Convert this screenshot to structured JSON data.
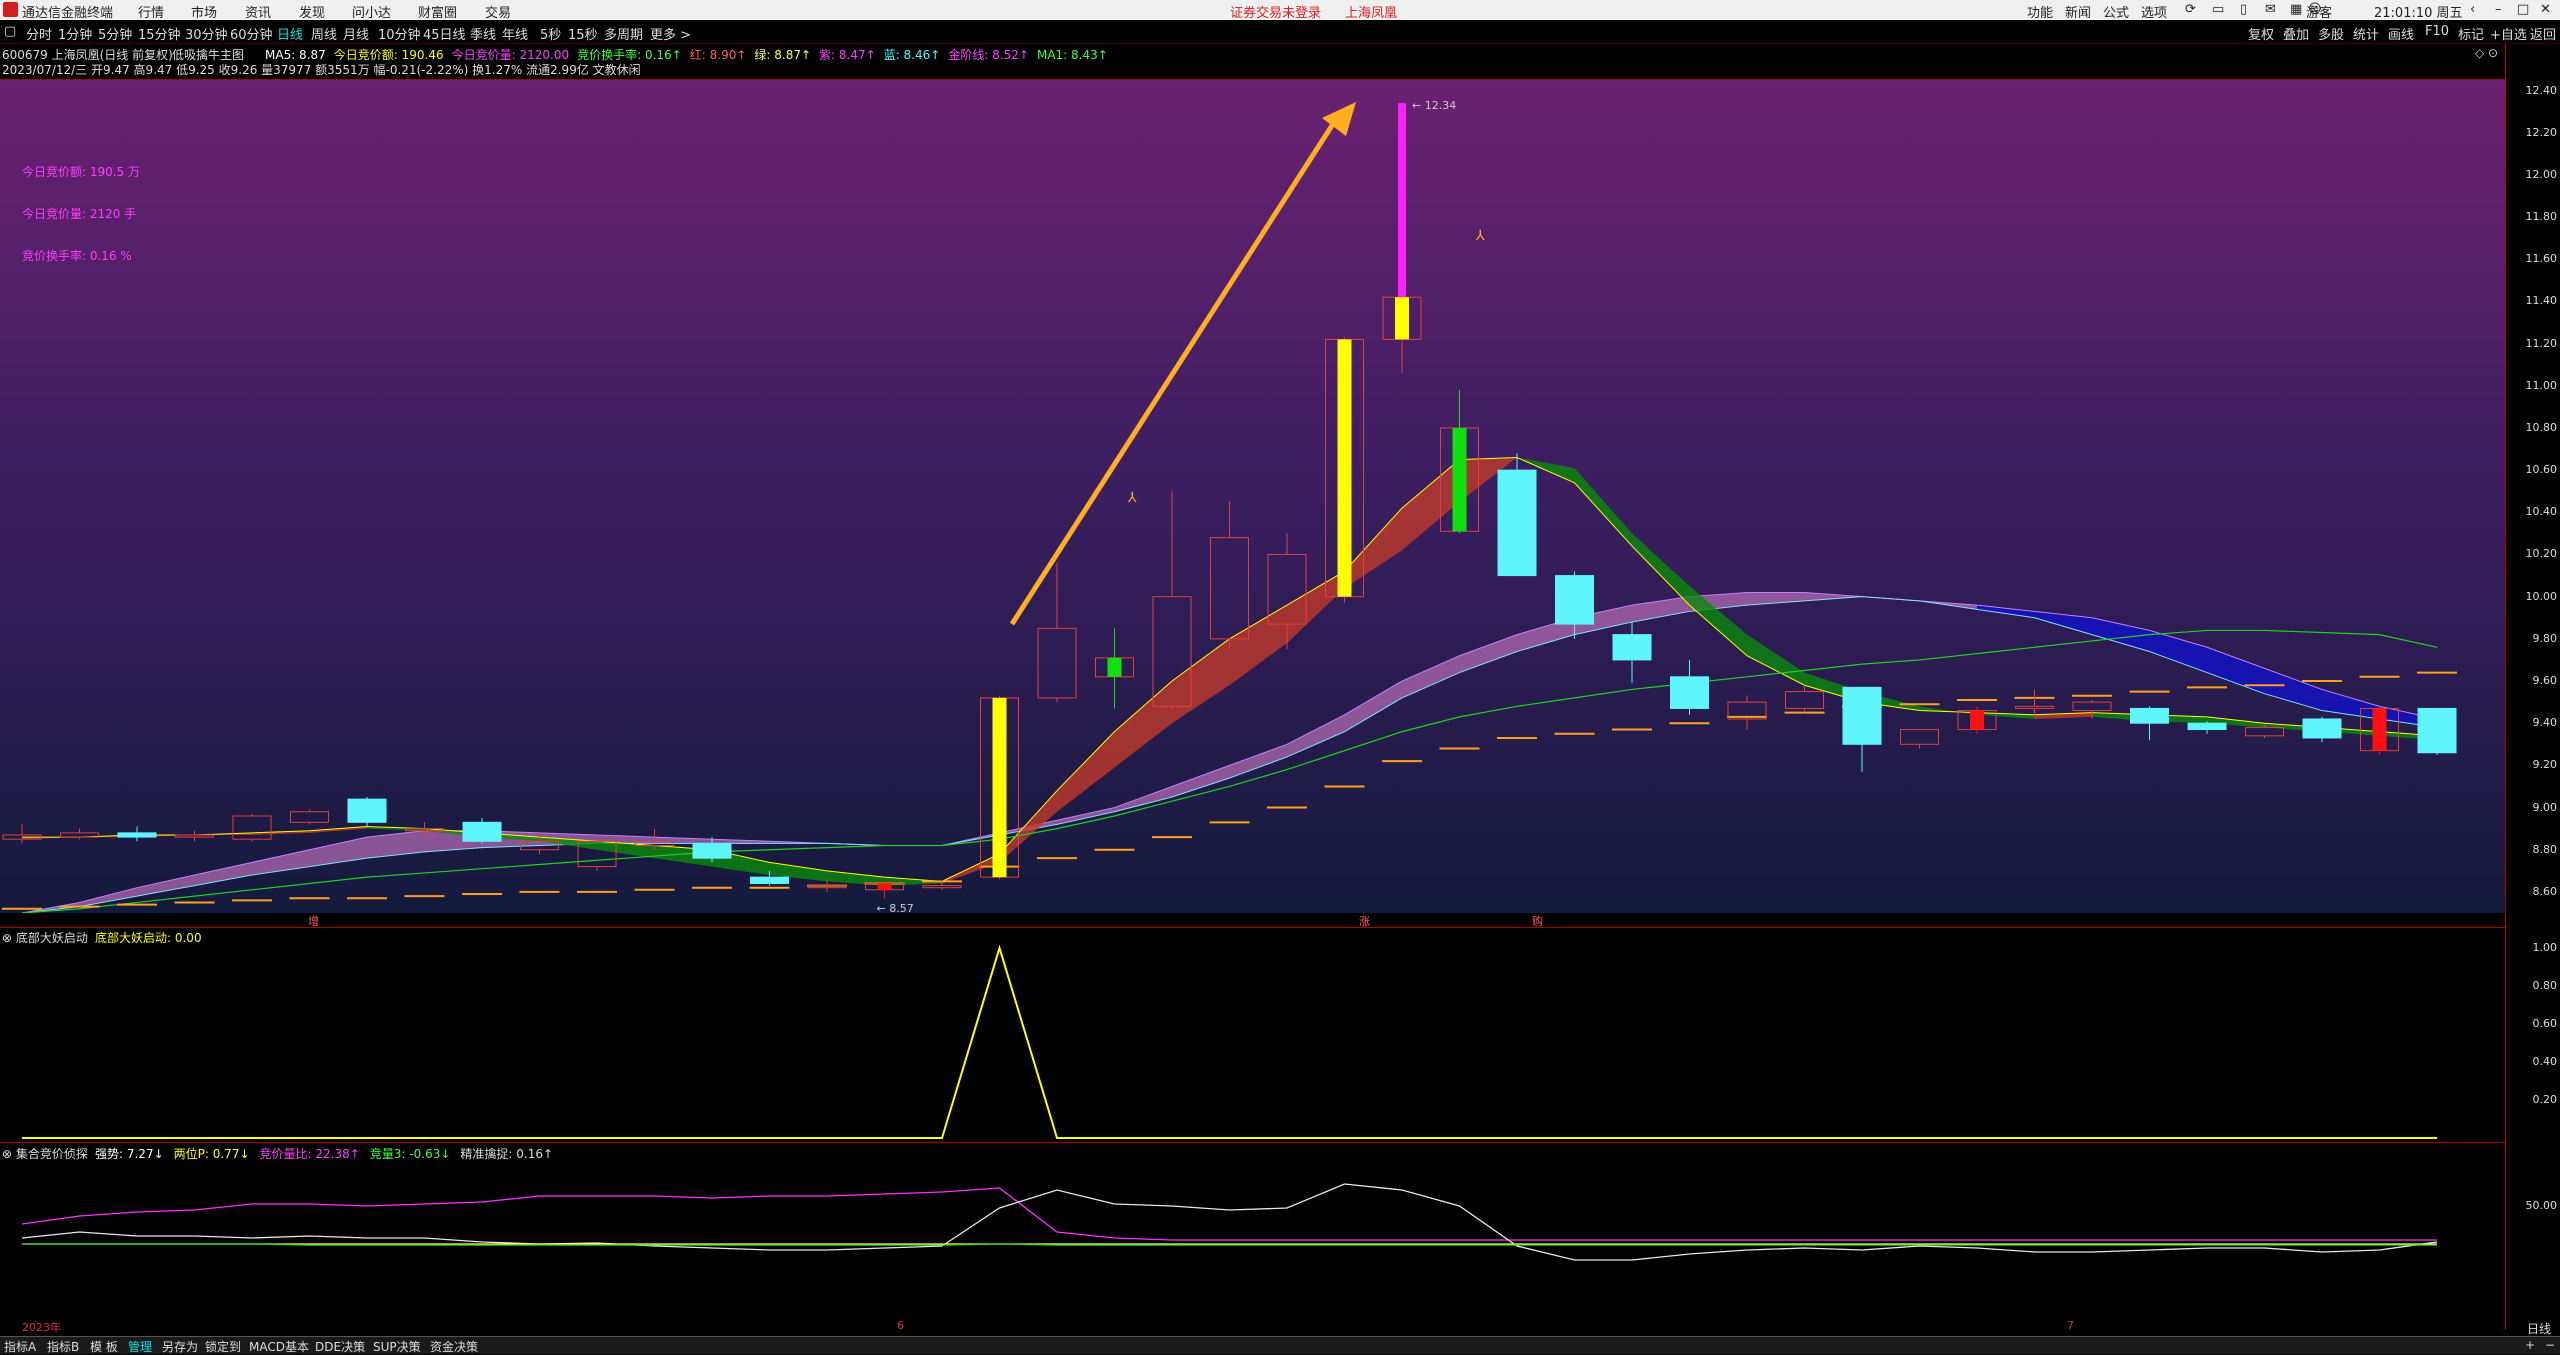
{
  "titlebar": {
    "app_name": "通达信金融终端",
    "menu": [
      "行情",
      "市场",
      "资讯",
      "发现",
      "问小达",
      "财富圈",
      "交易"
    ],
    "notice": "证券交易未登录",
    "notice_stock": "上海凤凰",
    "right_menu": [
      "功能",
      "新闻",
      "公式",
      "选项"
    ],
    "user": "游客",
    "clock": "21:01:10 周五"
  },
  "timeframes": {
    "items": [
      "分时",
      "1分钟",
      "5分钟",
      "15分钟",
      "30分钟",
      "60分钟",
      "日线",
      "周线",
      "月线",
      "10分钟",
      "45日线",
      "季线",
      "年线",
      "5秒",
      "15秒",
      "多周期",
      "更多 >"
    ],
    "active_index": 6,
    "right_tools": [
      "复权",
      "叠加",
      "多股",
      "统计",
      "画线",
      "F10",
      "标记",
      "+自选",
      "返回"
    ]
  },
  "info": {
    "line1_stock": "600679 上海凤凰(日线 前复权)",
    "line1_indicator": "低吸擒牛主图",
    "line1_values": [
      {
        "label": "MA5: 8.87",
        "color": "#ffffff"
      },
      {
        "label": "今日竞价额: 190.46",
        "color": "#ffff00"
      },
      {
        "label": "今日竞价量: 2120.00",
        "color": "#ff40ff"
      },
      {
        "label": "竞价换手率: 0.16↑",
        "color": "#40ff40"
      },
      {
        "label": "红: 8.90↑",
        "color": "#ff6060"
      },
      {
        "label": "绿: 8.87↑",
        "color": "#ffff40"
      },
      {
        "label": "紫: 8.47↑",
        "color": "#ff40ff"
      },
      {
        "label": "蓝: 8.46↑",
        "color": "#40ffff"
      },
      {
        "label": "金阶线: 8.52↑",
        "color": "#ff40ff"
      },
      {
        "label": "MA1: 8.43↑",
        "color": "#40ff40"
      }
    ],
    "line2": "2023/07/12/三 开9.47 高9.47 低9.25 收9.26 量37977 额3551万 幅-0.21(-2.22%) 换1.27% 流通2.99亿 文教休闲"
  },
  "overlay_text": {
    "auction_amount": "今日竞价额:  190.5  万",
    "auction_volume": "今日竞价量:  2120  手",
    "auction_turnover": "竞价换手率:  0.16  %",
    "high_label": "12.34",
    "low_label": "8.57",
    "mark_zeng": "增",
    "mark_zhang": "涨",
    "mark_gou": "购"
  },
  "price_axis": {
    "ticks": [
      "12.40",
      "12.20",
      "12.00",
      "11.80",
      "11.60",
      "11.40",
      "11.20",
      "11.00",
      "10.80",
      "10.60",
      "10.40",
      "10.20",
      "10.00",
      "9.80",
      "9.60",
      "9.40",
      "9.20",
      "9.00",
      "8.80",
      "8.60"
    ]
  },
  "panel2": {
    "title": "底部大妖启动",
    "value_label": "底部大妖启动: 0.00",
    "ticks": [
      "1.00",
      "0.80",
      "0.60",
      "0.40",
      "0.20"
    ]
  },
  "panel3": {
    "title": "集合竞价侦探",
    "values": [
      {
        "label": "强势: 7.27↓",
        "color": "#ffffff"
      },
      {
        "label": "两位P: 0.77↓",
        "color": "#ffff00"
      },
      {
        "label": "竞价量比: 22.38↑",
        "color": "#ff40ff"
      },
      {
        "label": "竞量3: -0.63↓",
        "color": "#40ff40"
      },
      {
        "label": "精准擒捉: 0.16↑",
        "color": "#dddddd"
      }
    ],
    "ticks": [
      "50.00"
    ]
  },
  "datebar": {
    "labels": [
      "2023年",
      "6",
      "7"
    ],
    "right": "日线"
  },
  "bottom_tabs": [
    "指标A",
    "指标B",
    "模 板",
    "管理",
    "另存为",
    "锁定到",
    "MACD基本",
    "DDE决策",
    "SUP决策",
    "资金决策"
  ],
  "chart_data": {
    "type": "candlestick",
    "ylim": [
      8.5,
      12.45
    ],
    "candles": [
      {
        "o": 8.85,
        "c": 8.87,
        "h": 8.92,
        "l": 8.83,
        "color": "red"
      },
      {
        "o": 8.86,
        "c": 8.88,
        "h": 8.9,
        "l": 8.85,
        "color": "red"
      },
      {
        "o": 8.88,
        "c": 8.86,
        "h": 8.91,
        "l": 8.84,
        "color": "cyan"
      },
      {
        "o": 8.86,
        "c": 8.87,
        "h": 8.89,
        "l": 8.84,
        "color": "red"
      },
      {
        "o": 8.85,
        "c": 8.96,
        "h": 8.97,
        "l": 8.84,
        "color": "red"
      },
      {
        "o": 8.93,
        "c": 8.98,
        "h": 8.99,
        "l": 8.92,
        "color": "red"
      },
      {
        "o": 9.04,
        "c": 8.93,
        "h": 9.05,
        "l": 8.91,
        "color": "cyan"
      },
      {
        "o": 8.9,
        "c": 8.89,
        "h": 8.93,
        "l": 8.85,
        "color": "red"
      },
      {
        "o": 8.93,
        "c": 8.84,
        "h": 8.95,
        "l": 8.83,
        "color": "cyan"
      },
      {
        "o": 8.8,
        "c": 8.84,
        "h": 8.88,
        "l": 8.78,
        "color": "red"
      },
      {
        "o": 8.72,
        "c": 8.84,
        "h": 8.86,
        "l": 8.7,
        "color": "red"
      },
      {
        "o": 8.82,
        "c": 8.84,
        "h": 8.9,
        "l": 8.8,
        "color": "red"
      },
      {
        "o": 8.83,
        "c": 8.76,
        "h": 8.86,
        "l": 8.74,
        "color": "cyan"
      },
      {
        "o": 8.67,
        "c": 8.64,
        "h": 8.7,
        "l": 8.63,
        "color": "cyan"
      },
      {
        "o": 8.62,
        "c": 8.63,
        "h": 8.66,
        "l": 8.6,
        "color": "red"
      },
      {
        "o": 8.64,
        "c": 8.61,
        "h": 8.65,
        "l": 8.57,
        "color": "redfill"
      },
      {
        "o": 8.62,
        "c": 8.63,
        "h": 8.65,
        "l": 8.61,
        "color": "red"
      },
      {
        "o": 8.67,
        "c": 9.52,
        "h": 9.53,
        "l": 8.66,
        "color": "yellow"
      },
      {
        "o": 9.52,
        "c": 9.85,
        "h": 10.16,
        "l": 9.5,
        "color": "red"
      },
      {
        "o": 9.71,
        "c": 9.62,
        "h": 9.85,
        "l": 9.47,
        "color": "green"
      },
      {
        "o": 9.48,
        "c": 10.0,
        "h": 10.5,
        "l": 9.46,
        "color": "red"
      },
      {
        "o": 9.8,
        "c": 10.28,
        "h": 10.45,
        "l": 9.76,
        "color": "red"
      },
      {
        "o": 9.87,
        "c": 10.2,
        "h": 10.3,
        "l": 9.75,
        "color": "red"
      },
      {
        "o": 10.0,
        "c": 11.22,
        "h": 11.23,
        "l": 9.97,
        "color": "yellow"
      },
      {
        "o": 11.22,
        "c": 11.42,
        "h": 12.34,
        "l": 11.06,
        "color": "yellowmag"
      },
      {
        "o": 10.8,
        "c": 10.31,
        "h": 10.98,
        "l": 10.3,
        "color": "green"
      },
      {
        "o": 10.6,
        "c": 10.1,
        "h": 10.68,
        "l": 10.1,
        "color": "cyan"
      },
      {
        "o": 10.1,
        "c": 9.87,
        "h": 10.12,
        "l": 9.8,
        "color": "cyan"
      },
      {
        "o": 9.82,
        "c": 9.7,
        "h": 9.88,
        "l": 9.59,
        "color": "cyan"
      },
      {
        "o": 9.62,
        "c": 9.47,
        "h": 9.7,
        "l": 9.44,
        "color": "cyan"
      },
      {
        "o": 9.42,
        "c": 9.5,
        "h": 9.53,
        "l": 9.37,
        "color": "red"
      },
      {
        "o": 9.47,
        "c": 9.55,
        "h": 9.58,
        "l": 9.45,
        "color": "red"
      },
      {
        "o": 9.57,
        "c": 9.3,
        "h": 9.57,
        "l": 9.17,
        "color": "cyan"
      },
      {
        "o": 9.3,
        "c": 9.37,
        "h": 9.37,
        "l": 9.28,
        "color": "red"
      },
      {
        "o": 9.37,
        "c": 9.46,
        "h": 9.48,
        "l": 9.35,
        "color": "redfill"
      },
      {
        "o": 9.47,
        "c": 9.48,
        "h": 9.56,
        "l": 9.43,
        "color": "red"
      },
      {
        "o": 9.46,
        "c": 9.5,
        "h": 9.51,
        "l": 9.42,
        "color": "red"
      },
      {
        "o": 9.47,
        "c": 9.4,
        "h": 9.48,
        "l": 9.32,
        "color": "cyan"
      },
      {
        "o": 9.4,
        "c": 9.37,
        "h": 9.41,
        "l": 9.35,
        "color": "cyan"
      },
      {
        "o": 9.34,
        "c": 9.38,
        "h": 9.39,
        "l": 9.33,
        "color": "red"
      },
      {
        "o": 9.42,
        "c": 9.33,
        "h": 9.43,
        "l": 9.31,
        "color": "cyan"
      },
      {
        "o": 9.47,
        "c": 9.27,
        "h": 9.48,
        "l": 9.25,
        "color": "redfill"
      },
      {
        "o": 9.47,
        "c": 9.26,
        "h": 9.47,
        "l": 9.25,
        "color": "cyan"
      }
    ],
    "steps": [
      8.52,
      8.53,
      8.54,
      8.55,
      8.56,
      8.57,
      8.57,
      8.58,
      8.59,
      8.6,
      8.6,
      8.61,
      8.62,
      8.62,
      8.63,
      8.64,
      8.65,
      8.72,
      8.76,
      8.8,
      8.86,
      8.93,
      9.0,
      9.1,
      9.22,
      9.28,
      9.33,
      9.35,
      9.37,
      9.4,
      9.43,
      9.45,
      9.48,
      9.49,
      9.51,
      9.52,
      9.53,
      9.55,
      9.57,
      9.58,
      9.6,
      9.62,
      9.64
    ],
    "ma_green": [
      8.5,
      8.52,
      8.55,
      8.58,
      8.61,
      8.64,
      8.67,
      8.69,
      8.71,
      8.73,
      8.75,
      8.77,
      8.79,
      8.8,
      8.81,
      8.82,
      8.82,
      8.85,
      8.9,
      8.96,
      9.03,
      9.1,
      9.18,
      9.27,
      9.36,
      9.43,
      9.48,
      9.52,
      9.56,
      9.59,
      9.62,
      9.65,
      9.68,
      9.7,
      9.73,
      9.76,
      9.79,
      9.82,
      9.84,
      9.84,
      9.83,
      9.82,
      9.76
    ],
    "band1_top": [
      8.86,
      8.86,
      8.87,
      8.87,
      8.88,
      8.89,
      8.91,
      8.9,
      8.88,
      8.86,
      8.84,
      8.82,
      8.8,
      8.74,
      8.7,
      8.67,
      8.65,
      8.78,
      9.08,
      9.36,
      9.6,
      9.8,
      9.96,
      10.12,
      10.42,
      10.65,
      10.66,
      10.54,
      10.24,
      9.96,
      9.72,
      9.58,
      9.5,
      9.46,
      9.45,
      9.44,
      9.45,
      9.44,
      9.43,
      9.4,
      9.38,
      9.36,
      9.34
    ],
    "band1_bot": [
      8.85,
      8.86,
      8.86,
      8.87,
      8.87,
      8.88,
      8.9,
      8.89,
      8.86,
      8.84,
      8.8,
      8.76,
      8.72,
      8.68,
      8.65,
      8.63,
      8.64,
      8.74,
      8.98,
      9.19,
      9.4,
      9.58,
      9.78,
      10.04,
      10.22,
      10.45,
      10.66,
      10.61,
      10.3,
      10.05,
      9.82,
      9.64,
      9.55,
      9.48,
      9.44,
      9.42,
      9.43,
      9.41,
      9.4,
      9.38,
      9.36,
      9.34,
      9.32
    ],
    "band2_top": [
      8.5,
      8.55,
      8.62,
      8.68,
      8.74,
      8.8,
      8.86,
      8.89,
      8.89,
      8.88,
      8.87,
      8.86,
      8.85,
      8.84,
      8.83,
      8.82,
      8.82,
      8.88,
      8.94,
      9.0,
      9.1,
      9.2,
      9.3,
      9.44,
      9.6,
      9.72,
      9.82,
      9.9,
      9.96,
      10.0,
      10.02,
      10.02,
      10.0,
      9.98,
      9.96,
      9.93,
      9.9,
      9.84,
      9.76,
      9.66,
      9.56,
      9.48,
      9.42
    ],
    "band2_bot": [
      8.5,
      8.53,
      8.58,
      8.63,
      8.68,
      8.72,
      8.76,
      8.79,
      8.81,
      8.82,
      8.83,
      8.83,
      8.83,
      8.83,
      8.83,
      8.82,
      8.82,
      8.87,
      8.92,
      8.98,
      9.05,
      9.14,
      9.24,
      9.36,
      9.52,
      9.64,
      9.74,
      9.82,
      9.88,
      9.93,
      9.96,
      9.98,
      10.0,
      9.98,
      9.94,
      9.9,
      9.82,
      9.74,
      9.64,
      9.54,
      9.46,
      9.42,
      9.38
    ],
    "band2_split": 34,
    "panel2_values": [
      0,
      0,
      0,
      0,
      0,
      0,
      0,
      0,
      0,
      0,
      0,
      0,
      0,
      0,
      0,
      0,
      0,
      1,
      0,
      0,
      0,
      0,
      0,
      0,
      0,
      0,
      0,
      0,
      0,
      0,
      0,
      0,
      0,
      0,
      0,
      0,
      0,
      0,
      0,
      0,
      0,
      0,
      0
    ],
    "panel3_white": [
      18,
      24,
      20,
      20,
      18,
      20,
      18,
      18,
      14,
      12,
      13,
      10,
      8,
      6,
      6,
      8,
      10,
      48,
      66,
      52,
      50,
      46,
      48,
      72,
      66,
      50,
      10,
      -4,
      -4,
      2,
      6,
      8,
      6,
      10,
      8,
      4,
      4,
      6,
      8,
      8,
      4,
      6,
      14
    ],
    "panel3_magenta": [
      32,
      40,
      44,
      46,
      52,
      52,
      50,
      52,
      54,
      60,
      60,
      60,
      58,
      60,
      60,
      62,
      64,
      68,
      24,
      18,
      16,
      16,
      16,
      16,
      16,
      16,
      16,
      16,
      16,
      16,
      16,
      16,
      16,
      16,
      16,
      16,
      16,
      16,
      16,
      16,
      16,
      16,
      16
    ],
    "panel3_yellow": [
      12,
      12,
      12,
      12,
      12,
      12,
      12,
      12,
      12,
      12,
      12,
      12,
      12,
      12,
      12,
      12,
      12,
      12,
      12,
      12,
      12,
      12,
      12,
      12,
      12,
      12,
      12,
      12,
      12,
      12,
      12,
      12,
      12,
      12,
      12,
      12,
      12,
      12,
      12,
      12,
      12,
      12,
      12
    ],
    "panel3_green": [
      12,
      12,
      12,
      12,
      12,
      11,
      11,
      11,
      11,
      11,
      11,
      11,
      11,
      11,
      11,
      11,
      11,
      12,
      11,
      11,
      11,
      11,
      11,
      11,
      11,
      11,
      11,
      11,
      11,
      11,
      11,
      11,
      11,
      11,
      11,
      11,
      11,
      11,
      11,
      11,
      11,
      11,
      11
    ]
  }
}
